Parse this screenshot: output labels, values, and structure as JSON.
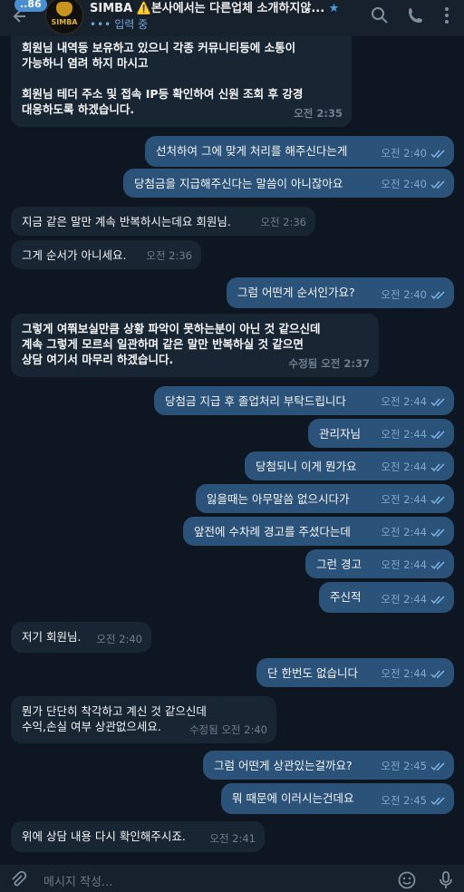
{
  "header": {
    "unread": "..86",
    "avatar_text": "SIMBA",
    "title_name": "SIMBA",
    "title_warning": "⚠️",
    "title_rest": "본사에서는 다른업체 소개하지않...",
    "status": "입력 중"
  },
  "messages": [
    {
      "text": "회원님 내역등 보유하고 있으니 각종 커뮤니티등에 소통이\n가능하니 염려 하지 마시고\n\n회원님 테더 주소 및 접속 IP등 확인하여 신원 조회 후 강경\n대응하도록 하겠습니다.",
      "time": "오전 2:35"
    },
    {
      "text": "선처하여 그에 맞게 처리를 해주신다는게",
      "time": "오전 2:40"
    },
    {
      "text": "당첨금을 지급해주신다는 말씀이 아니잖아요",
      "time": "오전 2:40"
    },
    {
      "text": "지금 같은 말만 계속 반복하시는데요 회원님.",
      "time": "오전 2:36"
    },
    {
      "text": "그게 순서가 아니세요.",
      "time": "오전 2:36"
    },
    {
      "text": "그럼 어떤게 순서인가요?",
      "time": "오전 2:40"
    },
    {
      "text": "그렇게 여쭤보실만큼 상황 파악이 못하는분이 아닌 것 같으신데\n계속 그렇게 모르쇠 일관하며 같은 말만 반복하실 것 같으면\n상담 여기서 마무리 하겠습니다.",
      "time": "수정됨 오전 2:37"
    },
    {
      "text": "당첨금 지급 후 졸업처리 부탁드립니다",
      "time": "오전 2:44"
    },
    {
      "text": "관리자님",
      "time": "오전 2:44"
    },
    {
      "text": "당첨되니 이게 뭔가요",
      "time": "오전 2:44"
    },
    {
      "text": "잃을때는 아무말씀 없으시다가",
      "time": "오전 2:44"
    },
    {
      "text": "앞전에 수차례 경고를 주셨다는데",
      "time": "오전 2:44"
    },
    {
      "text": "그런 경고",
      "time": "오전 2:44"
    },
    {
      "text": "주신적",
      "time": "오전 2:44"
    },
    {
      "text": "저기 회원님.",
      "time": "오전 2:40"
    },
    {
      "text": "단 한번도 없습니다",
      "time": "오전 2:44"
    },
    {
      "text": "뭔가 단단히 착각하고 계신 것 같으신데\n수익,손실 여부 상관없으세요.",
      "time": "수정됨 오전 2:40"
    },
    {
      "text": "그럼 어떤게 상관있는걸까요?",
      "time": "오전 2:45"
    },
    {
      "text": "뭐 때문에 이러시는건데요",
      "time": "오전 2:45"
    },
    {
      "text": "위에 상담 내용 다시 확인해주시죠.",
      "time": "오전 2:41"
    }
  ],
  "composer": {
    "placeholder": "메시지 작성..."
  },
  "colors": {
    "background": "#0e1621",
    "incoming_bubble": "#182533",
    "outgoing_bubble": "#2b5278",
    "accent": "#4a9be0"
  }
}
